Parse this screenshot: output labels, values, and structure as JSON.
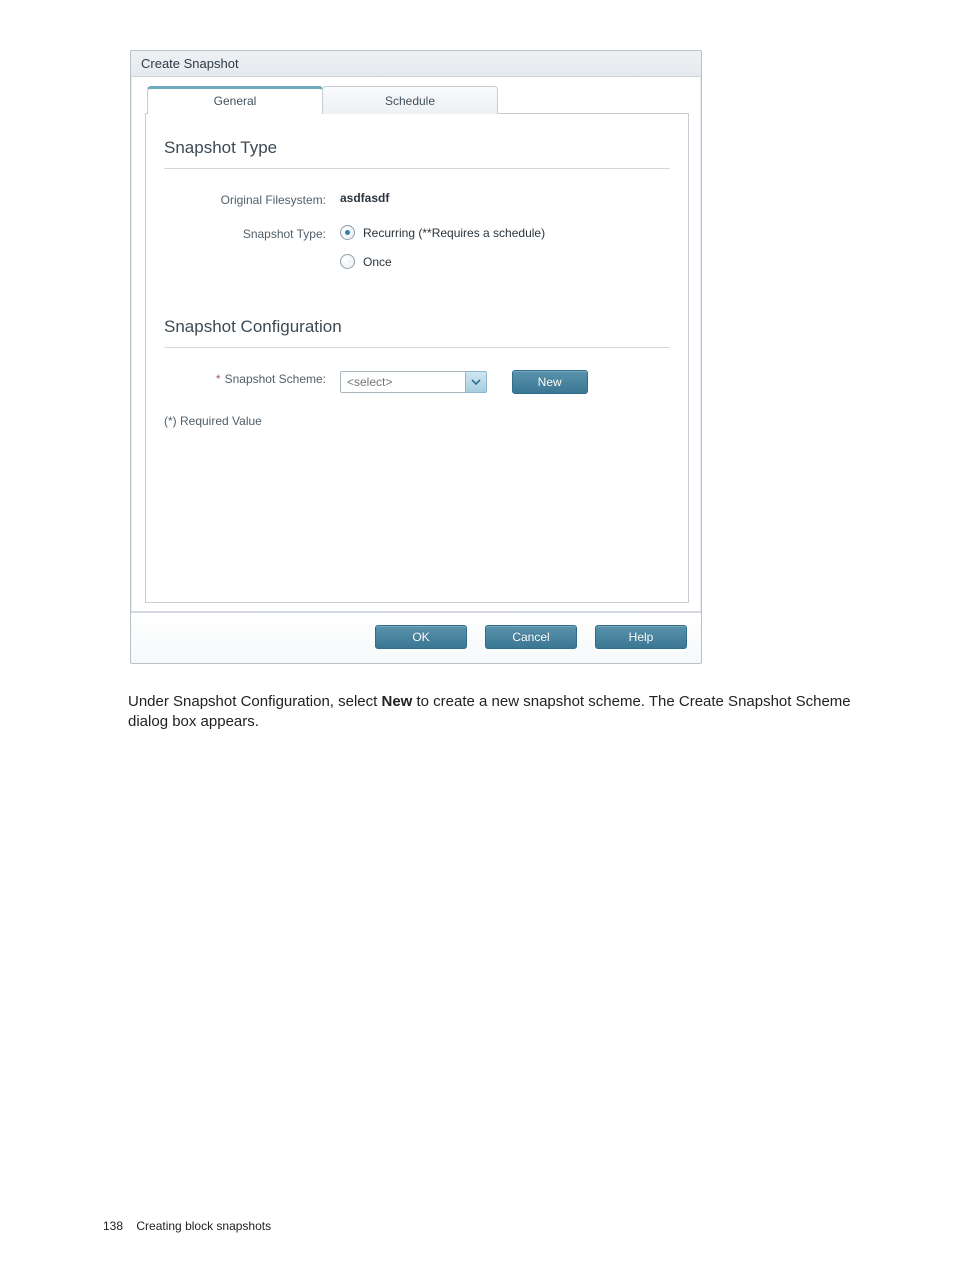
{
  "dialog": {
    "title": "Create Snapshot",
    "tabs": {
      "general": "General",
      "schedule": "Schedule"
    },
    "section1_title": "Snapshot Type",
    "orig_fs_label": "Original Filesystem:",
    "orig_fs_value": "asdfasdf",
    "snap_type_label": "Snapshot Type:",
    "radio_recurring": "Recurring (**Requires a schedule)",
    "radio_once": "Once",
    "section2_title": "Snapshot Configuration",
    "scheme_label": "Snapshot Scheme:",
    "scheme_star": "*",
    "scheme_placeholder": "<select>",
    "new_btn": "New",
    "required_note": "(*) Required Value",
    "buttons": {
      "ok": "OK",
      "cancel": "Cancel",
      "help": "Help"
    }
  },
  "caption": {
    "pre": "Under Snapshot Configuration, select ",
    "bold": "New",
    "post": " to create a new snapshot scheme. The Create Snapshot Scheme dialog box appears."
  },
  "footer": {
    "page_no": "138",
    "section": "Creating block snapshots"
  }
}
